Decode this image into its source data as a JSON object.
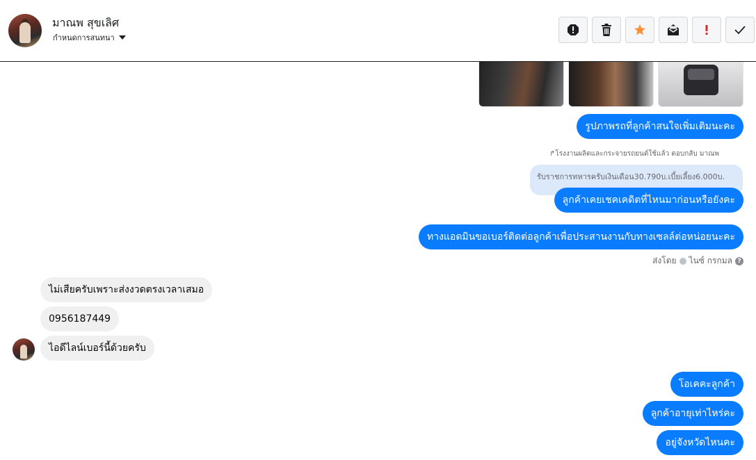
{
  "header": {
    "contact_name": "มาณพ สุขเลิศ",
    "assign_label": "กำหนดการสนทนา",
    "tools": [
      "spam-icon",
      "trash-icon",
      "star-icon",
      "mark-unread-icon",
      "important-icon",
      "done-icon"
    ],
    "accent_star": "#f7923a",
    "accent_important": "#e4282a"
  },
  "conversation": {
    "image_caption": "รูปภาพรถที่ลูกค้าสนใจเพิ่มเติมนะคะ",
    "reply_note": "↱โรงงานผลิตและกระจายรถยนต์ใช้แล้ว ตอบกลับ มาณพ",
    "quoted_text": "รับราชการทหารครับเงินเดือน30.790บ.เบี้ยเลี้ยง6.000บ.",
    "out_msg_1": "ลูกค้าเคยเชคเคดิตที่ไหนมาก่อนหรือยังคะ",
    "out_msg_2": "ทางแอดมินขอเบอร์ติดต่อลูกค้าเพื่อประสานงานกับทางเซลล์ต่อหน่อยนะคะ",
    "sent_by_label": "ส่งโดย",
    "sent_by_name": "ไนซ์ กรกมล",
    "in_msg_1": "ไม่เสียครับเพราะส่งงวดตรงเวลาเสมอ",
    "in_msg_2": "0956187449",
    "in_msg_3": "ไอดีไลน์เบอร์นี้ด้วยครับ",
    "out_msg_3": "โอเคคะลูกค้า",
    "out_msg_4": "ลูกค้าอายุเท่าไหร่คะ",
    "out_msg_5": "อยู่จังหวัดไหนคะ",
    "outgoing_color": "#0a7cff",
    "incoming_color": "#f0f0f0"
  }
}
